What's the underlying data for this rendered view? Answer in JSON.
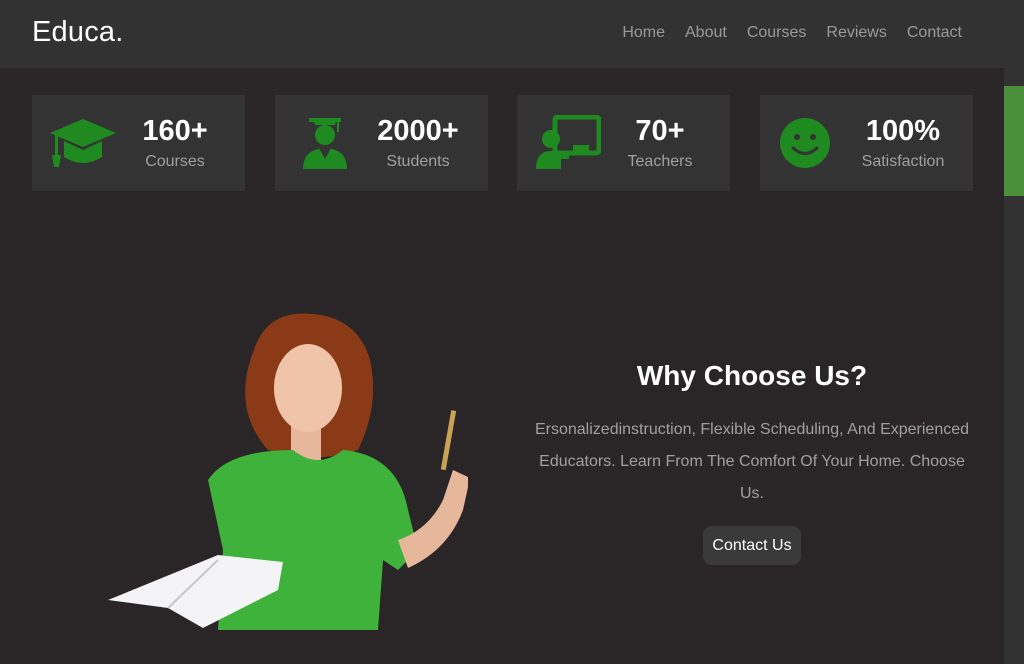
{
  "brand": {
    "logo_text": "Educa."
  },
  "nav": {
    "items": [
      {
        "label": "Home"
      },
      {
        "label": "About"
      },
      {
        "label": "Courses"
      },
      {
        "label": "Reviews"
      },
      {
        "label": "Contact"
      }
    ]
  },
  "stats": [
    {
      "icon": "graduation-cap-icon",
      "value": "160+",
      "label": "Courses"
    },
    {
      "icon": "student-icon",
      "value": "2000+",
      "label": "Students"
    },
    {
      "icon": "teacher-board-icon",
      "value": "70+",
      "label": "Teachers"
    },
    {
      "icon": "smile-icon",
      "value": "100%",
      "label": "Satisfaction"
    }
  ],
  "why": {
    "title": "Why Choose Us?",
    "description": "Ersonalizedinstruction, Flexible Scheduling, And Experienced Educators. Learn From The Comfort Of Your Home. Choose Us.",
    "button_label": "Contact Us"
  },
  "colors": {
    "accent_green": "#1f8a1f",
    "background": "#2a2526",
    "navbar": "#323232",
    "card": "#333333",
    "scrollbar_thumb": "#4a8f3a"
  }
}
